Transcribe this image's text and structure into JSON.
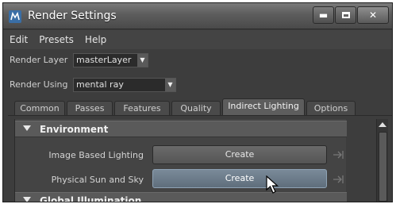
{
  "window": {
    "title": "Render Settings"
  },
  "menu": {
    "items": [
      "Edit",
      "Presets",
      "Help"
    ]
  },
  "render_layer": {
    "label": "Render Layer",
    "value": "masterLayer"
  },
  "render_using": {
    "label": "Render Using",
    "value": "mental ray"
  },
  "tabs": [
    "Common",
    "Passes",
    "Features",
    "Quality",
    "Indirect Lighting",
    "Options"
  ],
  "active_tab": "Indirect Lighting",
  "sections": {
    "environment": {
      "title": "Environment",
      "rows": [
        {
          "label": "Image Based Lighting",
          "button": "Create"
        },
        {
          "label": "Physical Sun and Sky",
          "button": "Create"
        }
      ]
    },
    "global_illumination": {
      "title": "Global Illumination"
    }
  },
  "colors": {
    "window_bg": "#3d3d3d",
    "panel_bg": "#444444",
    "header_bg": "#5a5a5a",
    "hover_button": "#6f8090"
  }
}
